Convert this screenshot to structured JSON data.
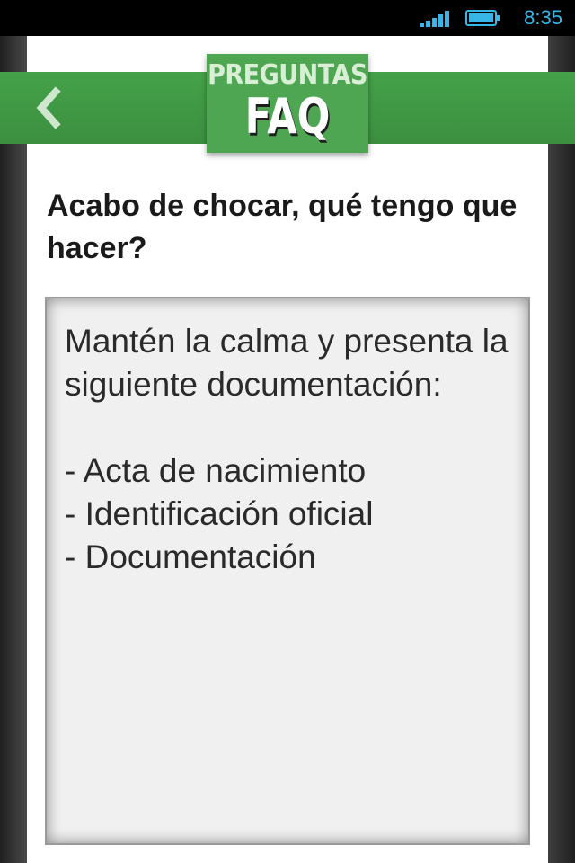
{
  "status_bar": {
    "time": "8:35",
    "signal_icon": "signal-bars-icon",
    "battery_icon": "battery-icon",
    "accent_color": "#38b6e8"
  },
  "header": {
    "back_icon": "chevron-left-icon",
    "logo_top": "PREGUNTAS",
    "logo_main": "FAQ",
    "brand_color": "#45a24a"
  },
  "question": "Acabo de chocar, qué tengo que hacer?",
  "answer": "Mantén la calma y presenta la siguiente documentación:\n\n- Acta de nacimiento\n- Identificación oficial\n- Documentación"
}
